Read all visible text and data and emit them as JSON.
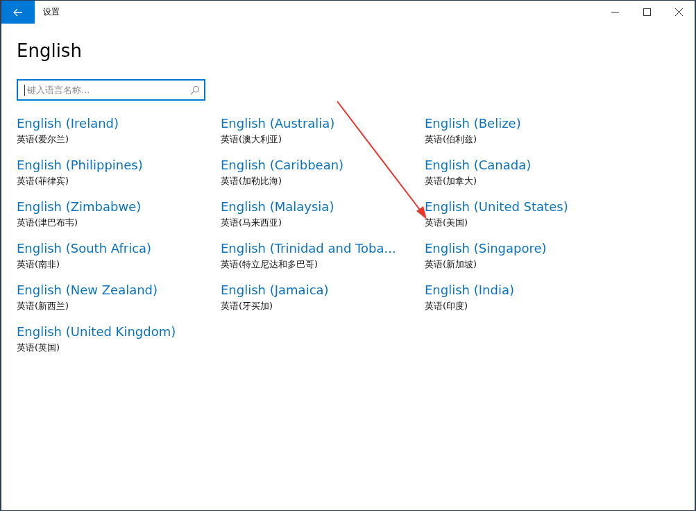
{
  "window": {
    "title": "设置"
  },
  "heading": "English",
  "search": {
    "placeholder": "键入语言名称..."
  },
  "languages": [
    {
      "name": "English (Ireland)",
      "native": "英语(爱尔兰)"
    },
    {
      "name": "English (Australia)",
      "native": "英语(澳大利亚)"
    },
    {
      "name": "English (Belize)",
      "native": "英语(伯利兹)"
    },
    {
      "name": "English (Philippines)",
      "native": "英语(菲律宾)"
    },
    {
      "name": "English (Caribbean)",
      "native": "英语(加勒比海)"
    },
    {
      "name": "English (Canada)",
      "native": "英语(加拿大)"
    },
    {
      "name": "English (Zimbabwe)",
      "native": "英语(津巴布韦)"
    },
    {
      "name": "English (Malaysia)",
      "native": "英语(马来西亚)"
    },
    {
      "name": "English (United States)",
      "native": "英语(美国)"
    },
    {
      "name": "English (South Africa)",
      "native": "英语(南非)"
    },
    {
      "name": "English (Trinidad and Toba...",
      "native": "英语(特立尼达和多巴哥)"
    },
    {
      "name": "English (Singapore)",
      "native": "英语(新加坡)"
    },
    {
      "name": "English (New Zealand)",
      "native": "英语(新西兰)"
    },
    {
      "name": "English (Jamaica)",
      "native": "英语(牙买加)"
    },
    {
      "name": "English (India)",
      "native": "英语(印度)"
    },
    {
      "name": "English (United Kingdom)",
      "native": "英语(英国)"
    }
  ]
}
